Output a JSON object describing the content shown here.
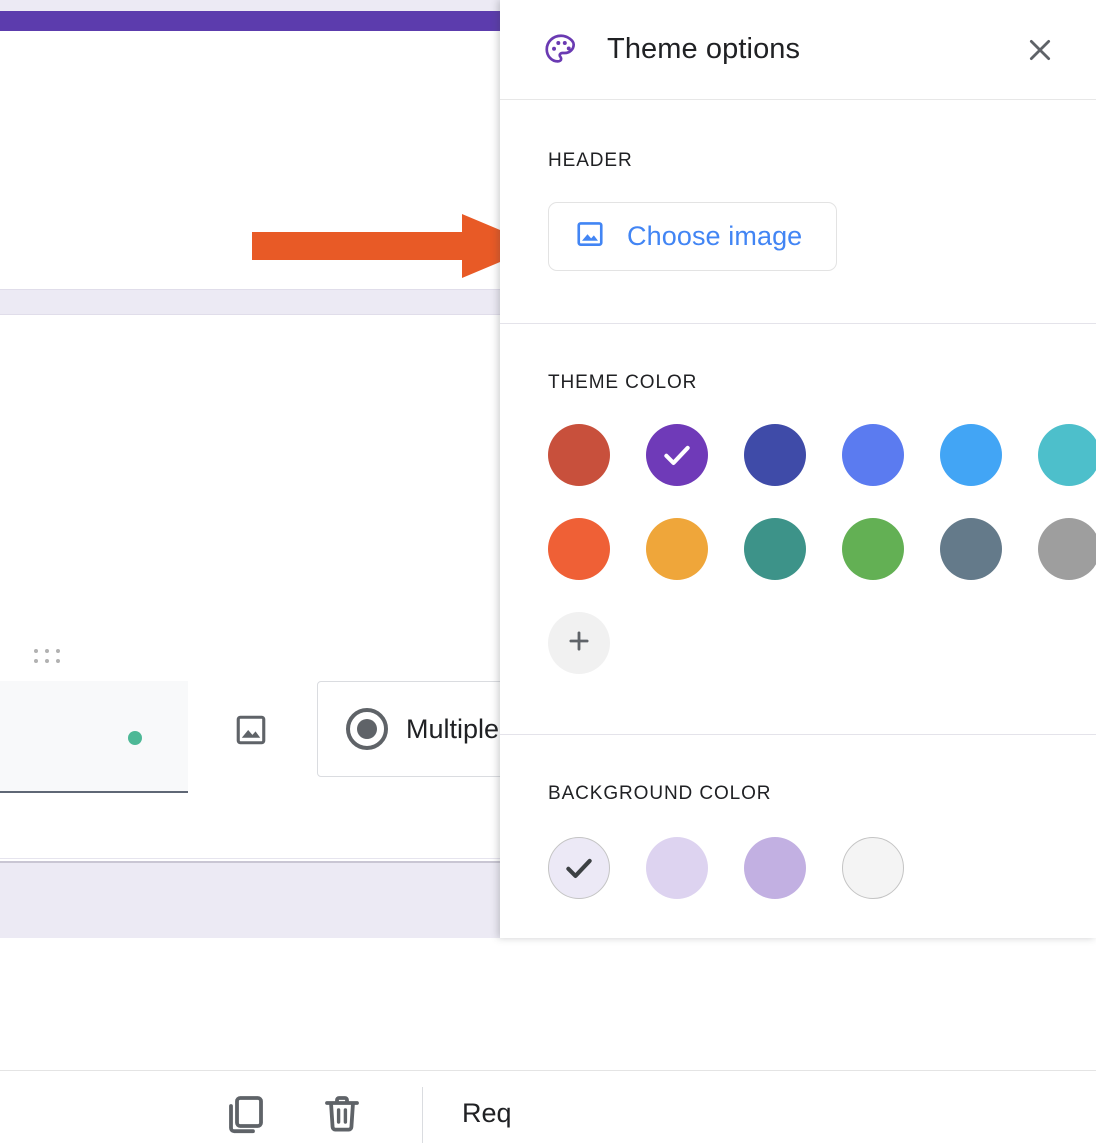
{
  "panel": {
    "title": "Theme options",
    "icon": "palette-icon",
    "close_icon": "close-icon",
    "sections": {
      "header": {
        "label": "HEADER",
        "choose_image_label": "Choose image",
        "choose_image_icon": "image-icon",
        "accent_color": "#4285f4"
      },
      "theme_color": {
        "label": "THEME COLOR",
        "selected_index": 1,
        "swatches": [
          {
            "name": "red",
            "hex": "#c8503c"
          },
          {
            "name": "purple",
            "hex": "#6f3ab8"
          },
          {
            "name": "indigo",
            "hex": "#3f4ba8"
          },
          {
            "name": "cornflower",
            "hex": "#5b7bf0"
          },
          {
            "name": "sky-blue",
            "hex": "#42a5f5"
          },
          {
            "name": "cyan",
            "hex": "#4dbfcb"
          },
          {
            "name": "orange",
            "hex": "#ef6036"
          },
          {
            "name": "amber",
            "hex": "#efa63a"
          },
          {
            "name": "teal",
            "hex": "#3d9389"
          },
          {
            "name": "green",
            "hex": "#63b054"
          },
          {
            "name": "slate",
            "hex": "#647a8a"
          },
          {
            "name": "gray",
            "hex": "#9e9e9e"
          }
        ],
        "add_custom_label": "+",
        "add_custom_icon": "plus-icon"
      },
      "background_color": {
        "label": "BACKGROUND COLOR",
        "selected_index": 0,
        "swatches": [
          {
            "name": "lightest-lavender",
            "hex": "#ece9f6",
            "bordered": true
          },
          {
            "name": "light-lavender",
            "hex": "#ddd3f0",
            "bordered": false
          },
          {
            "name": "medium-lavender",
            "hex": "#c2b0e2",
            "bordered": false
          },
          {
            "name": "white",
            "hex": "#f4f4f4",
            "bordered": true
          }
        ]
      }
    }
  },
  "background_app": {
    "top_bar_color": "#5c3cad",
    "page_background_color": "#eceaf4",
    "question": {
      "type_label": "Multiple",
      "type_icon": "radio-button-icon",
      "image_icon": "image-icon",
      "drag_handle_icon": "drag-handle-icon",
      "status_dot_color": "#4db896"
    },
    "footer": {
      "duplicate_icon": "copy-icon",
      "delete_icon": "trash-icon",
      "required_label": "Req"
    }
  },
  "annotation": {
    "arrow": {
      "name": "pointer-arrow",
      "color": "#e85a26",
      "direction": "right"
    }
  }
}
